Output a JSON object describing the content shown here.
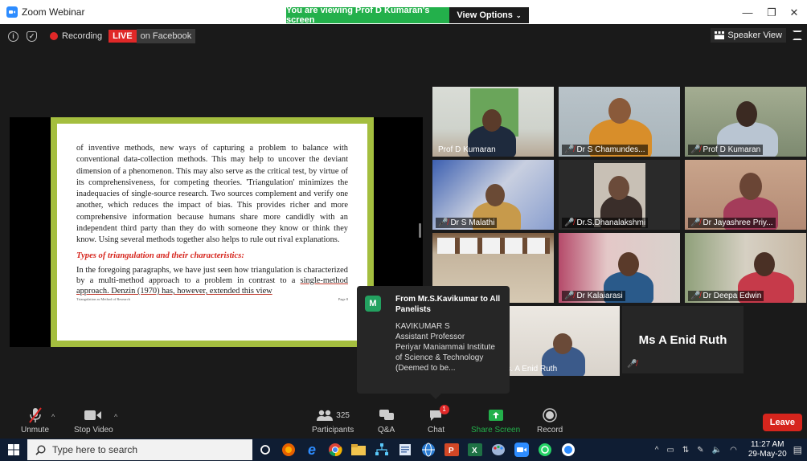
{
  "window": {
    "app_title": "Zoom Webinar",
    "banner_viewing": "You are viewing Prof D Kumaran's screen",
    "banner_options": "View Options",
    "controls": {
      "minimize": "—",
      "maximize": "❐",
      "close": "✕"
    }
  },
  "top_bar": {
    "recording_label": "Recording",
    "live_badge": "LIVE",
    "live_platform": "on Facebook",
    "view_mode": "Speaker View"
  },
  "slide": {
    "paragraph1": "of inventive methods, new ways of capturing a problem to balance with conventional data-collection methods. This may help to uncover the deviant dimension of a phenomenon. This may also serve as the critical test, by virtue of its comprehensiveness, for competing theories. 'Triangulation' minimizes the inadequacies of single-source research. Two sources complement and verify one another, which reduces the impact of bias. This provides richer and more comprehensive information because humans share more candidly with an independent third party than they do with someone they know or think they know. Using several methods together also helps to rule out rival explanations.",
    "heading": "Types of triangulation and their characteristics:",
    "paragraph2_a": "In the foregoing paragraphs, we have just seen how triangulation is characterized by a multi-method approach to a problem in contrast to a ",
    "paragraph2_b": "single-method approach. Denzin (1970) has, however, extended this view",
    "footer_left": "Triangulation as Method of Research",
    "footer_right": "Page 8",
    "colors": {
      "border": "#a4be3f",
      "heading": "#d6251d"
    }
  },
  "gallery": {
    "tiles": [
      {
        "name": "Prof D Kumaran",
        "muted": false,
        "active": true
      },
      {
        "name": "Dr S Chamundes...",
        "muted": true
      },
      {
        "name": "Prof D Kumaran",
        "muted": true
      },
      {
        "name": "Dr S Malathi",
        "muted": true
      },
      {
        "name": "Dr.S.Dhanalakshmi",
        "muted": true
      },
      {
        "name": "Dr Jayashree Priy...",
        "muted": true
      },
      {
        "name": "",
        "muted": false
      },
      {
        "name": "Dr Kalaiarasi",
        "muted": true
      },
      {
        "name": "Dr Deepa Edwin",
        "muted": true
      },
      {
        "name": "rs. A Enid Ruth",
        "muted": false
      },
      {
        "name": "Ms A Enid Ruth",
        "muted": true
      }
    ]
  },
  "chat_popup": {
    "avatar_letter": "M",
    "from_line": "From Mr.S.Kavikumar to All Panelists",
    "message_lines": [
      "KAVIKUMAR S",
      "Assistant Professor",
      "Periyar Maniammai Institute",
      "of Science & Technology",
      "(Deemed to be..."
    ]
  },
  "controls": {
    "unmute": "Unmute",
    "stop_video": "Stop Video",
    "participants": "Participants",
    "participants_count": "325",
    "qa": "Q&A",
    "chat": "Chat",
    "chat_badge": "1",
    "share_screen": "Share Screen",
    "record": "Record",
    "leave": "Leave",
    "colors": {
      "share": "#23b04b",
      "leave": "#d6251d"
    }
  },
  "taskbar": {
    "search_placeholder": "Type here to search",
    "time": "11:27 AM",
    "date": "29-May-20"
  }
}
